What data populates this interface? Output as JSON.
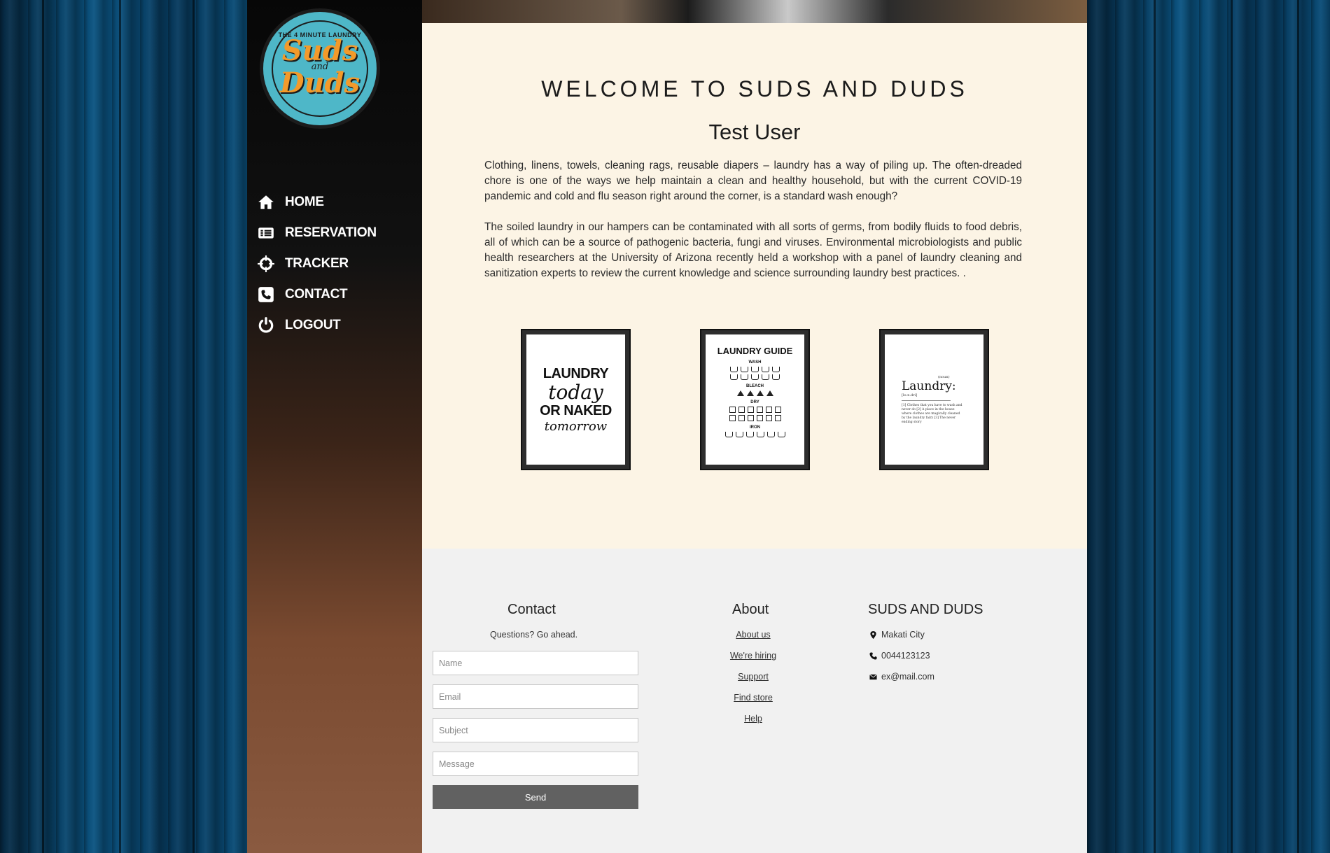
{
  "brand": {
    "logo_top_text": "THE 4 MINUTE LAUNDRY",
    "logo_word1": "Suds",
    "logo_and": "and",
    "logo_word2": "Duds",
    "accent_teal": "#4eb7c8",
    "accent_orange": "#f39a2a"
  },
  "nav": {
    "items": [
      {
        "label": "HOME",
        "icon": "home-icon"
      },
      {
        "label": "RESERVATION",
        "icon": "reservation-icon"
      },
      {
        "label": "TRACKER",
        "icon": "crosshair-icon"
      },
      {
        "label": "CONTACT",
        "icon": "phone-icon"
      },
      {
        "label": "LOGOUT",
        "icon": "power-icon"
      }
    ]
  },
  "main": {
    "welcome": "WELCOME TO SUDS AND DUDS",
    "user_name": "Test User",
    "paragraph1": "Clothing, linens, towels, cleaning rags, reusable diapers – laundry has a way of piling up. The often-dreaded chore is one of the ways we help maintain a clean and healthy household, but with the current COVID-19 pandemic and cold and flu season right around the corner, is a standard wash enough?",
    "paragraph2": "The soiled laundry in our hampers can be contaminated with all sorts of germs, from bodily fluids to food debris, all of which can be a source of pathogenic bacteria, fungi and viruses. Environmental microbiologists and public health researchers at the University of Arizona recently held a workshop with a panel of laundry cleaning and sanitization experts to review the current knowledge and science surrounding laundry best practices. .",
    "frames": {
      "frame1": {
        "line1": "LAUNDRY",
        "line2": "today",
        "line3": "OR NAKED",
        "line4": "tomorrow"
      },
      "frame2": {
        "title": "LAUNDRY GUIDE",
        "sections": [
          "WASH",
          "BLEACH",
          "DRY",
          "IRON"
        ]
      },
      "frame3": {
        "noun": "(noun)",
        "word": "Laundry:",
        "pron": "[lo:n.dri]",
        "definition": "[1] Clothes that you have to wash and never do [2] A place in the house where clothes are magically cleaned by the laundry fairy [3] The never ending story"
      }
    }
  },
  "footer": {
    "contact": {
      "title": "Contact",
      "subtitle": "Questions? Go ahead.",
      "name_placeholder": "Name",
      "email_placeholder": "Email",
      "subject_placeholder": "Subject",
      "message_placeholder": "Message",
      "send_label": "Send"
    },
    "about": {
      "title": "About",
      "links": [
        "About us",
        "We're hiring",
        "Support",
        "Find store",
        "Help"
      ]
    },
    "company": {
      "title": "SUDS AND DUDS",
      "location": "Makati City",
      "phone": "0044123123",
      "email": "ex@mail.com"
    }
  }
}
